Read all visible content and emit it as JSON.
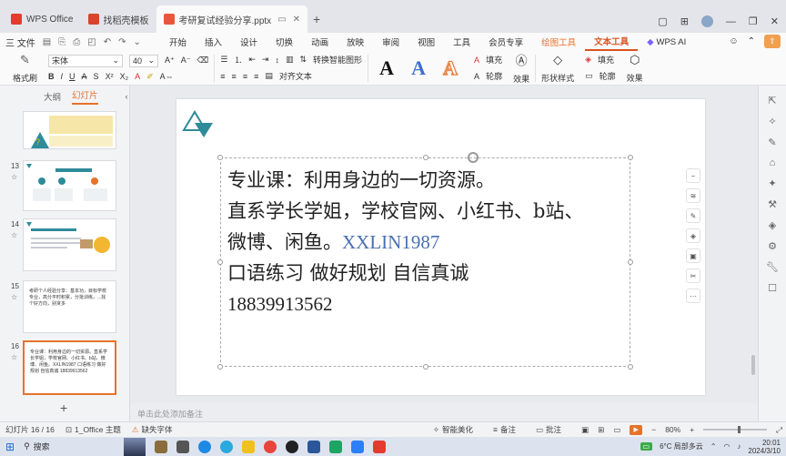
{
  "titlebar": {
    "tabs": [
      {
        "label": "WPS Office",
        "icon": "wps-logo-icon"
      },
      {
        "label": "找稻壳模板",
        "icon": "docer-icon"
      },
      {
        "label": "考研复试经验分享.pptx",
        "icon": "ppt-file-icon",
        "active": true
      }
    ],
    "new_tab": "+"
  },
  "menubar": {
    "file_label": "三 文件",
    "menus": [
      "开始",
      "插入",
      "设计",
      "切换",
      "动画",
      "放映",
      "审阅",
      "视图",
      "工具",
      "会员专享",
      "绘图工具",
      "文本工具"
    ],
    "orange_menu": "绘图工具",
    "active_menu": "文本工具",
    "wps_ai": "WPS AI"
  },
  "ribbon": {
    "format_painter": "格式刷",
    "font_name": "宋体",
    "font_size": "40",
    "bold": "B",
    "italic": "I",
    "underline": "U",
    "strikethrough": "A",
    "superscript": "S",
    "convert_smartart": "转换智能图形",
    "text_direction": "对齐文本",
    "style_A": "A",
    "fill_label": "填充",
    "outline_label": "轮廓",
    "effect_label": "效果",
    "shape_style": "形状样式",
    "shape_fill": "填充",
    "shape_outline": "轮廓",
    "shape_effect": "效果"
  },
  "leftpanel": {
    "tab_outline": "大纲",
    "tab_slides": "幻灯片",
    "slides": [
      {
        "num": "13"
      },
      {
        "num": "14"
      },
      {
        "num": "15",
        "text": "考研个人经验分享：基本功，目标学校专业，高分平时积累，分批训练，...找个好方向，别贪多"
      },
      {
        "num": "16",
        "text": "专业课：利用身边的一切资源。直系学长学姐，学校官网、小红书、b站、微博、闲鱼。XXLIN1987 口语练习 做好规划 自信真诚 18839913562"
      }
    ],
    "add_slide": "+"
  },
  "slide": {
    "lines": [
      "专业课：利用身边的一切资源。",
      "直系学长学姐，学校官网、小红书、b站、",
      "微博、闲鱼。",
      "口语练习  做好规划  自信真诚",
      "18839913562"
    ],
    "highlight": "XXLIN1987"
  },
  "notes_placeholder": "单击此处添加备注",
  "statusbar": {
    "slide_count": "幻灯片 16 / 16",
    "theme": "1_Office 主题",
    "missing_font": "缺失字体",
    "smart_beautify": "智能美化",
    "notes": "备注",
    "comments": "批注",
    "zoom": "80%"
  },
  "taskbar": {
    "search": "搜索",
    "weather": "6°C 局部多云",
    "time": "20:01",
    "date": "2024/3/10"
  }
}
